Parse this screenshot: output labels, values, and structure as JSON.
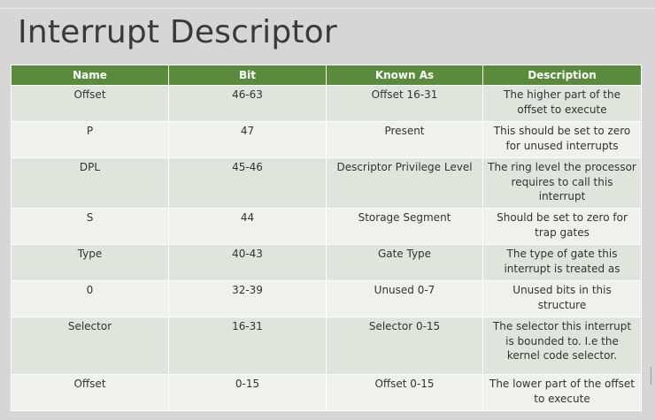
{
  "slide": {
    "title": "Interrupt Descriptor"
  },
  "table": {
    "headers": [
      "Name",
      "Bit",
      "Known As",
      "Description"
    ],
    "rows": [
      {
        "name": "Offset",
        "bit": "46-63",
        "known_as": "Offset 16-31",
        "description": "The higher part of the offset to execute"
      },
      {
        "name": "P",
        "bit": "47",
        "known_as": "Present",
        "description": "This should be set to zero for unused interrupts"
      },
      {
        "name": "DPL",
        "bit": "45-46",
        "known_as": "Descriptor Privilege Level",
        "description": "The ring level the processor requires to call this interrupt"
      },
      {
        "name": "S",
        "bit": "44",
        "known_as": "Storage Segment",
        "description": "Should be set to zero for trap gates"
      },
      {
        "name": "Type",
        "bit": "40-43",
        "known_as": "Gate Type",
        "description": "The type of gate this interrupt is treated as"
      },
      {
        "name": "0",
        "bit": "32-39",
        "known_as": "Unused 0-7",
        "description": "Unused bits in this structure"
      },
      {
        "name": "Selector",
        "bit": "16-31",
        "known_as": "Selector 0-15",
        "description": "The selector this interrupt is bounded to. I.e the kernel code selector."
      },
      {
        "name": "Offset",
        "bit": "0-15",
        "known_as": "Offset 0-15",
        "description": "The lower part of the offset to execute"
      }
    ]
  },
  "colors": {
    "header_bg": "#5a8b3c",
    "row_band_a": "#dfe5da",
    "row_band_b": "#eef1ec",
    "page_bg": "#d6d6d6"
  }
}
